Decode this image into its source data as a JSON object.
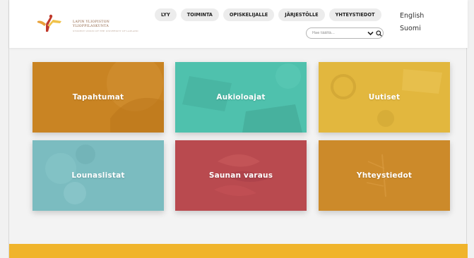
{
  "header": {
    "logo": {
      "line1": "LAPIN YLIOPISTON",
      "line2": "YLIOPPILASKUNTA",
      "tagline": "STUDENT UNION OF THE UNIVERSITY OF LAPLAND"
    },
    "nav": [
      {
        "label": "LYY"
      },
      {
        "label": "TOIMINTA"
      },
      {
        "label": "OPISKELIJALLE"
      },
      {
        "label": "JÄRJESTÖLLE"
      },
      {
        "label": "YHTEYSTIEDOT"
      }
    ],
    "languages": {
      "english": "English",
      "finnish": "Suomi"
    },
    "search": {
      "placeholder": "Hae täältä..."
    }
  },
  "tiles": [
    {
      "label": "Tapahtumat",
      "color": "#c98423"
    },
    {
      "label": "Aukioloajat",
      "color": "#4fc1ad"
    },
    {
      "label": "Uutiset",
      "color": "#e2b73e"
    },
    {
      "label": "Lounaslistat",
      "color": "#7bbcc0"
    },
    {
      "label": "Saunan varaus",
      "color": "#b94a4f"
    },
    {
      "label": "Yhteystiedot",
      "color": "#cc8a2a"
    }
  ],
  "colors": {
    "footer": "#f0b42b",
    "logo_orange": "#e8a13a",
    "logo_red": "#c0392b",
    "logo_yellow": "#f0c24a"
  }
}
